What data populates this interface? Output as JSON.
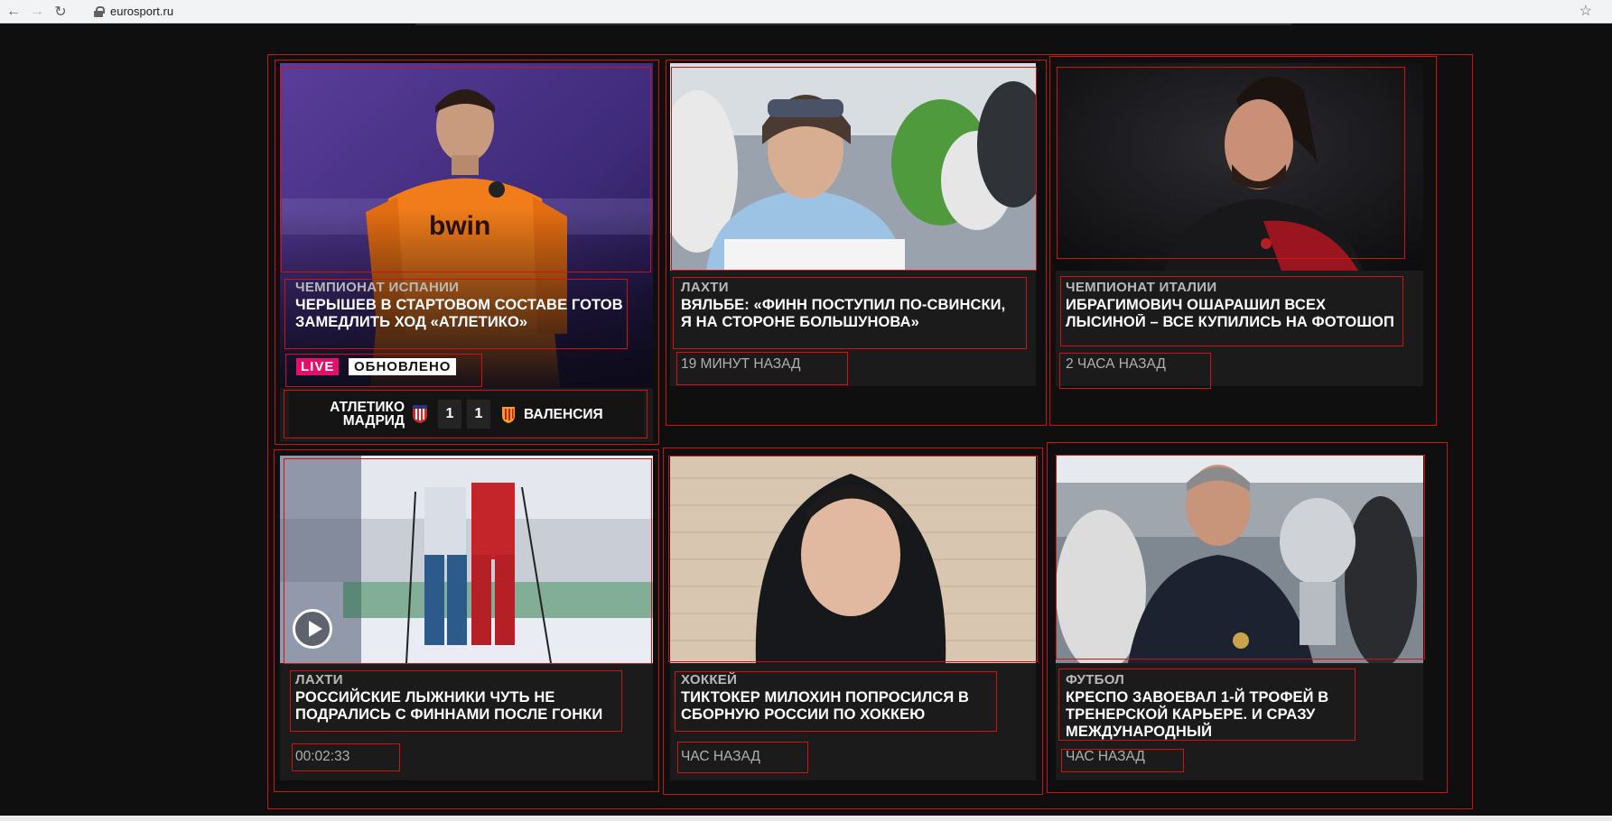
{
  "browser": {
    "url": "eurosport.ru",
    "back_icon": "arrow-left-icon",
    "forward_icon": "arrow-right-icon",
    "reload_icon": "reload-icon",
    "star_icon": "star-icon"
  },
  "cards": [
    {
      "category": "ЧЕМПИОНАТ ИСПАНИИ",
      "title_line1": "ЧЕРЫШЕВ В СТАРТОВОМ СОСТАВЕ ГОТОВ",
      "title_line2": "ЗАМЕДЛИТЬ ХОД «АТЛЕТИКО»",
      "live_label": "LIVE",
      "updated_label": "ОБНОВЛЕНО",
      "match": {
        "home_line1": "АТЛЕТИКО",
        "home_line2": "МАДРИД",
        "home_score": "1",
        "away_score": "1",
        "away": "ВАЛЕНСИЯ"
      }
    },
    {
      "category": "ЛАХТИ",
      "title_line1": "ВЯЛЬБЕ: «ФИНН ПОСТУПИЛ ПО-СВИНСКИ,",
      "title_line2": "Я НА СТОРОНЕ БОЛЬШУНОВА»",
      "time": "19 МИНУТ НАЗАД"
    },
    {
      "category": "ЧЕМПИОНАТ ИТАЛИИ",
      "title_line1": "ИБРАГИМОВИЧ ОШАРАШИЛ ВСЕХ",
      "title_line2": "ЛЫСИНОЙ – ВСЕ КУПИЛИСЬ НА ФОТОШОП",
      "time": "2 ЧАСА НАЗАД"
    },
    {
      "category": "ЛАХТИ",
      "title_line1": "РОССИЙСКИЕ ЛЫЖНИКИ ЧУТЬ НЕ",
      "title_line2": "ПОДРАЛИСЬ С ФИННАМИ ПОСЛЕ ГОНКИ",
      "duration": "00:02:33",
      "play_icon": "play-icon"
    },
    {
      "category": "ХОККЕЙ",
      "title_line1": "ТИКТОКЕР МИЛОХИН ПОПРОСИЛСЯ В",
      "title_line2": "СБОРНУЮ РОССИИ ПО ХОККЕЮ",
      "time": "ЧАС НАЗАД"
    },
    {
      "category": "ФУТБОЛ",
      "title_line1": "КРЕСПО ЗАВОЕВАЛ 1-Й ТРОФЕЙ В",
      "title_line2": "ТРЕНЕРСКОЙ КАРЬЕРЕ. И СРАЗУ",
      "title_line3": "МЕЖДУНАРОДНЫЙ",
      "time": "ЧАС НАЗАД"
    }
  ],
  "colors": {
    "page_bg": "#0f0f0f",
    "card_bg": "#1b1b1b",
    "live": "#e2106b",
    "annotation_box": "#d01212"
  }
}
